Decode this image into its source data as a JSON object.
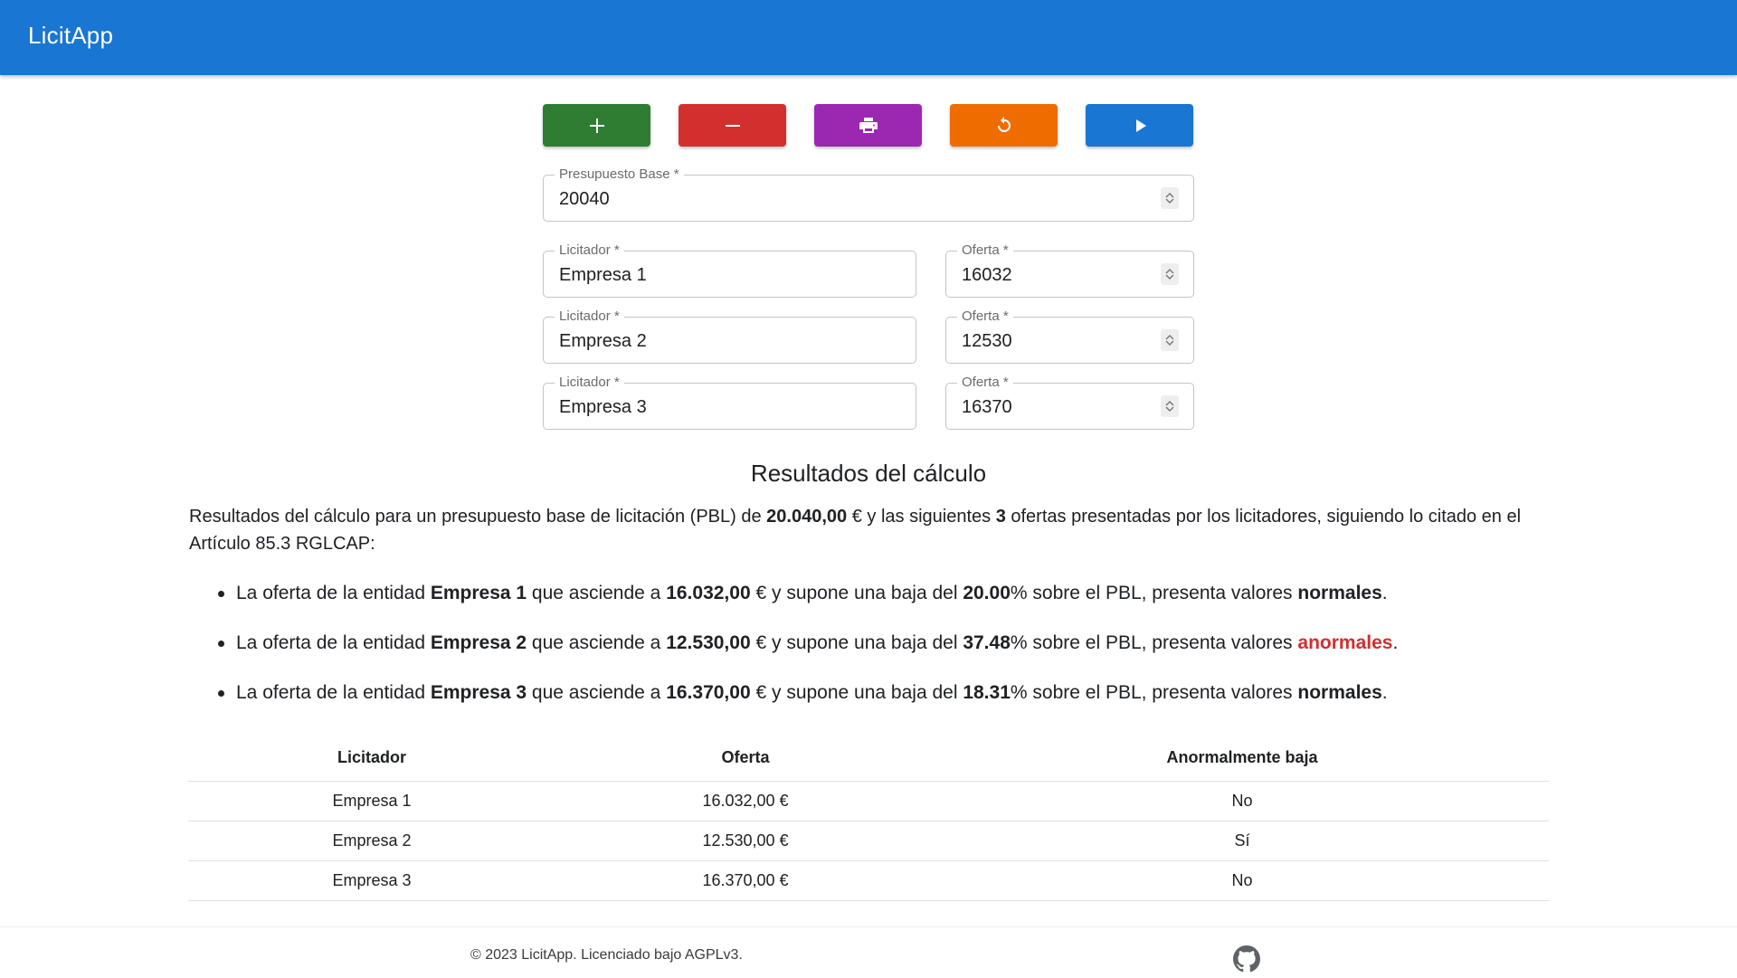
{
  "app": {
    "title": "LicitApp"
  },
  "toolbar": {
    "buttons": [
      {
        "icon": "plus-icon",
        "color": "#2e7d32"
      },
      {
        "icon": "minus-icon",
        "color": "#d32f2f"
      },
      {
        "icon": "print-icon",
        "color": "#9c27b0"
      },
      {
        "icon": "reset-icon",
        "color": "#ef6c00"
      },
      {
        "icon": "play-icon",
        "color": "#1976d2"
      }
    ]
  },
  "form": {
    "budget": {
      "label": "Presupuesto Base *",
      "value": "20040"
    },
    "bidders": [
      {
        "name_label": "Licitador *",
        "name": "Empresa 1",
        "offer_label": "Oferta *",
        "offer": "16032"
      },
      {
        "name_label": "Licitador *",
        "name": "Empresa 2",
        "offer_label": "Oferta *",
        "offer": "12530"
      },
      {
        "name_label": "Licitador *",
        "name": "Empresa 3",
        "offer_label": "Oferta *",
        "offer": "16370"
      }
    ]
  },
  "results": {
    "title": "Resultados del cálculo",
    "intro": {
      "t1": "Resultados del cálculo para un presupuesto base de licitación (PBL) de ",
      "pbl": "20.040,00",
      "t2": " € y las siguientes ",
      "count": "3",
      "t3": " ofertas presentadas por los licitadores, siguiendo lo citado en el Artículo 85.3 RGLCAP:"
    },
    "bullet_text": {
      "a": "La oferta de la entidad ",
      "b": " que asciende a ",
      "c": " € y supone una baja del ",
      "d": "% sobre el PBL, presenta valores ",
      "e": "."
    },
    "items": [
      {
        "entity": "Empresa 1",
        "amount": "16.032,00",
        "drop": "20.00",
        "verdict": "normales",
        "abnormal": false
      },
      {
        "entity": "Empresa 2",
        "amount": "12.530,00",
        "drop": "37.48",
        "verdict": "anormales",
        "abnormal": true
      },
      {
        "entity": "Empresa 3",
        "amount": "16.370,00",
        "drop": "18.31",
        "verdict": "normales",
        "abnormal": false
      }
    ]
  },
  "table": {
    "headers": [
      "Licitador",
      "Oferta",
      "Anormalmente baja"
    ],
    "rows": [
      [
        "Empresa 1",
        "16.032,00 €",
        "No"
      ],
      [
        "Empresa 2",
        "12.530,00 €",
        "Sí"
      ],
      [
        "Empresa 3",
        "16.370,00 €",
        "No"
      ]
    ]
  },
  "footer": {
    "copyright": "© 2023 LicitApp. Licenciado bajo AGPLv3.",
    "github_icon": "github-icon"
  }
}
